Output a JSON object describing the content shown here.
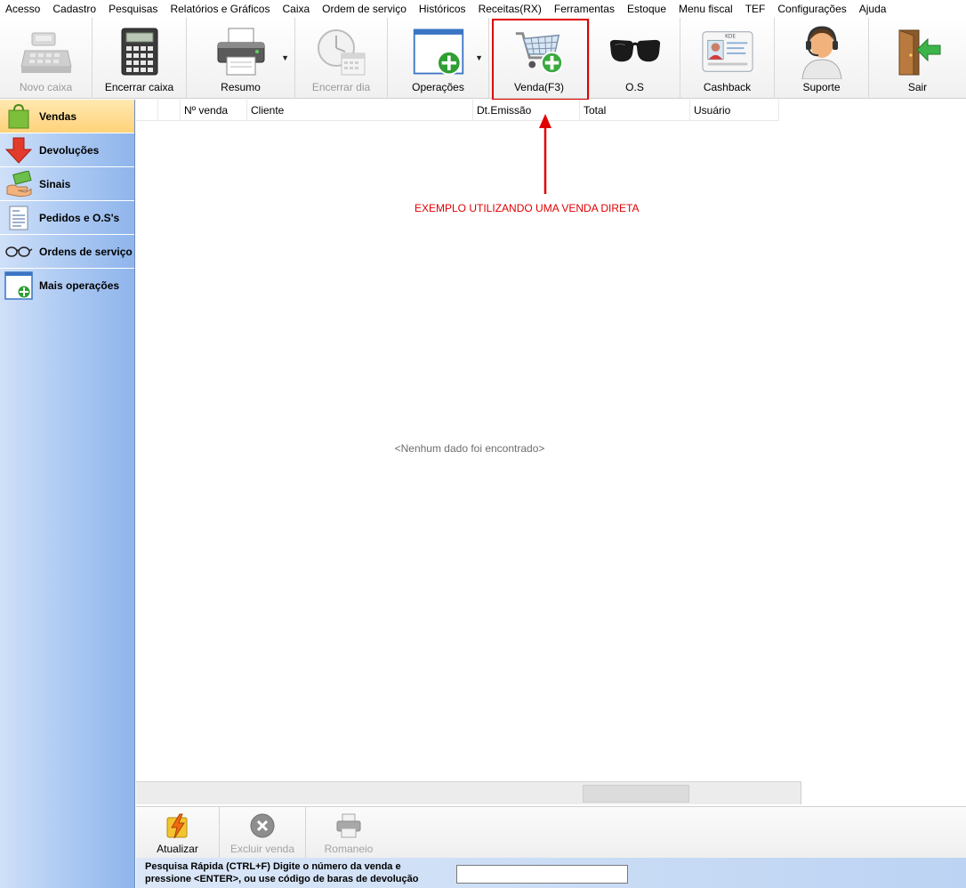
{
  "menu": [
    "Acesso",
    "Cadastro",
    "Pesquisas",
    "Relatórios e Gráficos",
    "Caixa",
    "Ordem de serviço",
    "Históricos",
    "Receitas(RX)",
    "Ferramentas",
    "Estoque",
    "Menu fiscal",
    "TEF",
    "Configurações",
    "Ajuda"
  ],
  "toolbar": {
    "novo_caixa": "Novo caixa",
    "encerrar_caixa": "Encerrar caixa",
    "resumo": "Resumo",
    "encerrar_dia": "Encerrar dia",
    "operacoes": "Operações",
    "venda": "Venda(F3)",
    "os": "O.S",
    "cashback": "Cashback",
    "card_tag": "KDE",
    "suporte": "Suporte",
    "sair": "Sair"
  },
  "sidebar": {
    "items": [
      {
        "label": "Vendas"
      },
      {
        "label": "Devoluções"
      },
      {
        "label": "Sinais"
      },
      {
        "label": "Pedidos e O.S's"
      },
      {
        "label": "Ordens de serviço"
      },
      {
        "label": "Mais operações"
      }
    ]
  },
  "grid": {
    "columns": [
      "",
      "",
      "Nº venda",
      "Cliente",
      "Dt.Emissão",
      "Total",
      "Usuário"
    ],
    "empty_text": "<Nenhum dado foi encontrado>"
  },
  "annotation": {
    "text": "EXEMPLO UTILIZANDO UMA VENDA DIRETA"
  },
  "bottom": {
    "atualizar": "Atualizar",
    "excluir": "Excluir venda",
    "romaneio": "Romaneio"
  },
  "quick_search": {
    "line1": "Pesquisa Rápida (CTRL+F) Digite o número da venda e",
    "line2": "pressione <ENTER>, ou use código de baras de devolução",
    "value": ""
  }
}
